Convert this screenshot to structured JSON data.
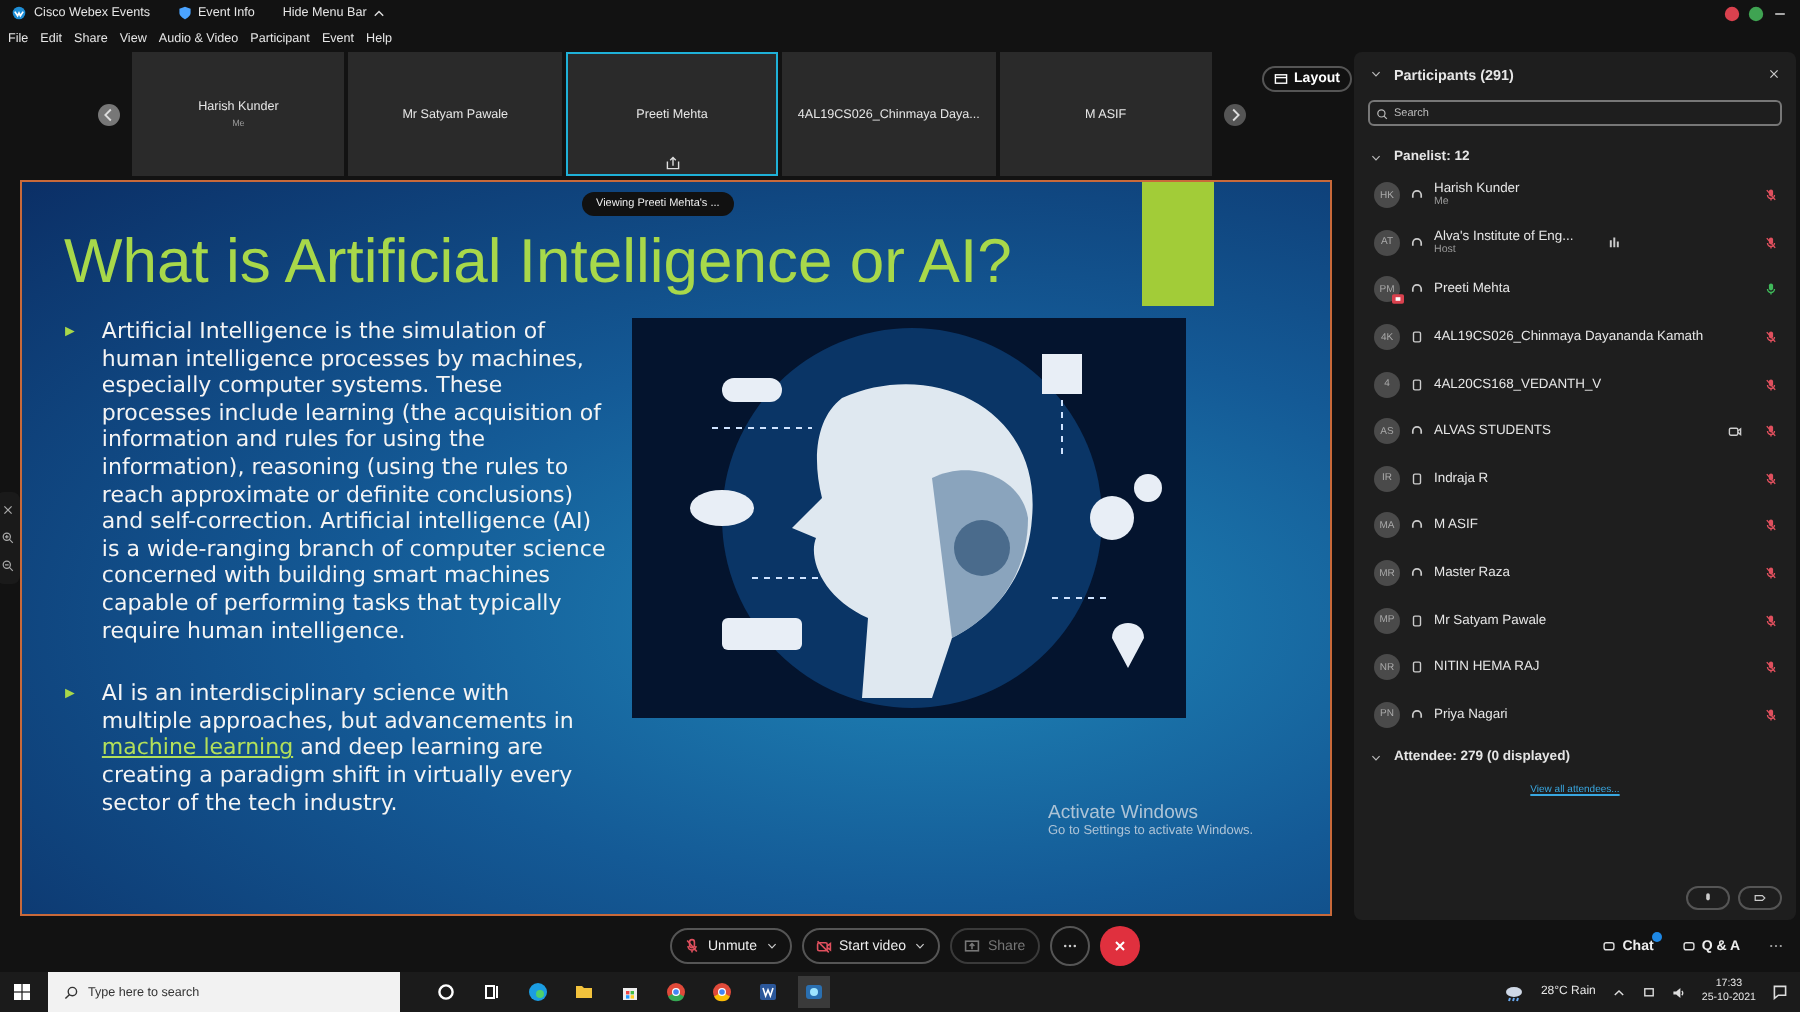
{
  "app_bar": {
    "title": "Cisco Webex Events",
    "event_info": "Event Info",
    "hide_menu": "Hide Menu Bar"
  },
  "menu": [
    "File",
    "Edit",
    "Share",
    "View",
    "Audio & Video",
    "Participant",
    "Event",
    "Help"
  ],
  "filmstrip": {
    "tiles": [
      {
        "name": "Harish Kunder",
        "sub": "Me",
        "selected": false,
        "sharing": false
      },
      {
        "name": "Mr Satyam Pawale",
        "selected": false,
        "sharing": false
      },
      {
        "name": "Preeti Mehta",
        "selected": true,
        "sharing": true
      },
      {
        "name": "4AL19CS026_Chinmaya Daya...",
        "selected": false,
        "sharing": false
      },
      {
        "name": "M ASIF",
        "selected": false,
        "sharing": false
      }
    ],
    "layout_button": "Layout"
  },
  "slide": {
    "viewing": "Viewing Preeti Mehta's ...",
    "title": "What is Artificial Intelligence or AI?",
    "bullets": [
      {
        "marker": "►",
        "text": "Artificial Intelligence is the simulation of human intelligence processes by machines, especially computer systems. These processes include learning (the acquisition of information and rules for using the information), reasoning (using the rules to reach approximate or definite conclusions) and self-correction. Artificial intelligence (AI) is a wide-ranging branch of computer science concerned with building smart machines capable of performing tasks that typically require human intelligence."
      },
      {
        "marker": "►",
        "text": "AI is an interdisciplinary science with multiple approaches, but advancements in",
        "link": "machine learning",
        "after": "and deep learning are creating a paradigm shift in virtually every sector of the tech industry."
      }
    ]
  },
  "watermark": {
    "title": "Activate Windows",
    "hint": "Go to Settings to activate Windows."
  },
  "participants": {
    "title": "Participants (291)",
    "search": {
      "placeholder": "Search"
    },
    "panelist_header": "Panelist: 12",
    "panelists": [
      {
        "initials": "HK",
        "name": "Harish Kunder",
        "sub": "Me",
        "kind": "headset",
        "muted": true,
        "speaking": false,
        "video": false,
        "presenting": false
      },
      {
        "initials": "AT",
        "name": "Alva's Institute of Eng...",
        "sub": "Host",
        "kind": "headset",
        "muted": true,
        "speaking": true,
        "video": false,
        "presenting": false
      },
      {
        "initials": "PM",
        "name": "Preeti Mehta",
        "kind": "headset",
        "muted": false,
        "speaking": false,
        "video": false,
        "presenting": true
      },
      {
        "initials": "4K",
        "name": "4AL19CS026_Chinmaya Dayananda Kamath",
        "kind": "phone",
        "muted": true,
        "speaking": false,
        "video": false,
        "presenting": false
      },
      {
        "initials": "4",
        "name": "4AL20CS168_VEDANTH_V",
        "kind": "phone",
        "muted": true,
        "speaking": false,
        "video": false,
        "presenting": false
      },
      {
        "initials": "AS",
        "name": "ALVAS STUDENTS",
        "kind": "headset",
        "muted": true,
        "speaking": false,
        "video": true,
        "presenting": false
      },
      {
        "initials": "IR",
        "name": "Indraja R",
        "kind": "phone",
        "muted": true,
        "speaking": false,
        "video": false,
        "presenting": false
      },
      {
        "initials": "MA",
        "name": "M ASIF",
        "kind": "headset",
        "muted": true,
        "speaking": false,
        "video": false,
        "presenting": false
      },
      {
        "initials": "MR",
        "name": "Master Raza",
        "kind": "headset",
        "muted": true,
        "speaking": false,
        "video": false,
        "presenting": false
      },
      {
        "initials": "MP",
        "name": "Mr Satyam Pawale",
        "kind": "phone",
        "muted": true,
        "speaking": false,
        "video": false,
        "presenting": false
      },
      {
        "initials": "NR",
        "name": "NITIN HEMA RAJ",
        "kind": "phone",
        "muted": true,
        "speaking": false,
        "video": false,
        "presenting": false
      },
      {
        "initials": "PN",
        "name": "Priya Nagari",
        "kind": "headset",
        "muted": true,
        "speaking": false,
        "video": false,
        "presenting": false
      }
    ],
    "attendee_header": "Attendee: 279 (0 displayed)",
    "view_all": "View all attendees..."
  },
  "controls": [
    {
      "kind": "mic",
      "label": "Unmute",
      "disabled": false
    },
    {
      "kind": "video",
      "label": "Start video",
      "disabled": false
    },
    {
      "kind": "share",
      "label": "Share",
      "disabled": true
    }
  ],
  "side_tabs": [
    {
      "label": "Chat",
      "unread": true
    },
    {
      "label": "Q & A",
      "unread": false
    }
  ],
  "taskbar": {
    "search": {
      "placeholder": "Type here to search"
    },
    "weather": "28°C Rain",
    "time": "17:33",
    "date": "25-10-2021"
  }
}
